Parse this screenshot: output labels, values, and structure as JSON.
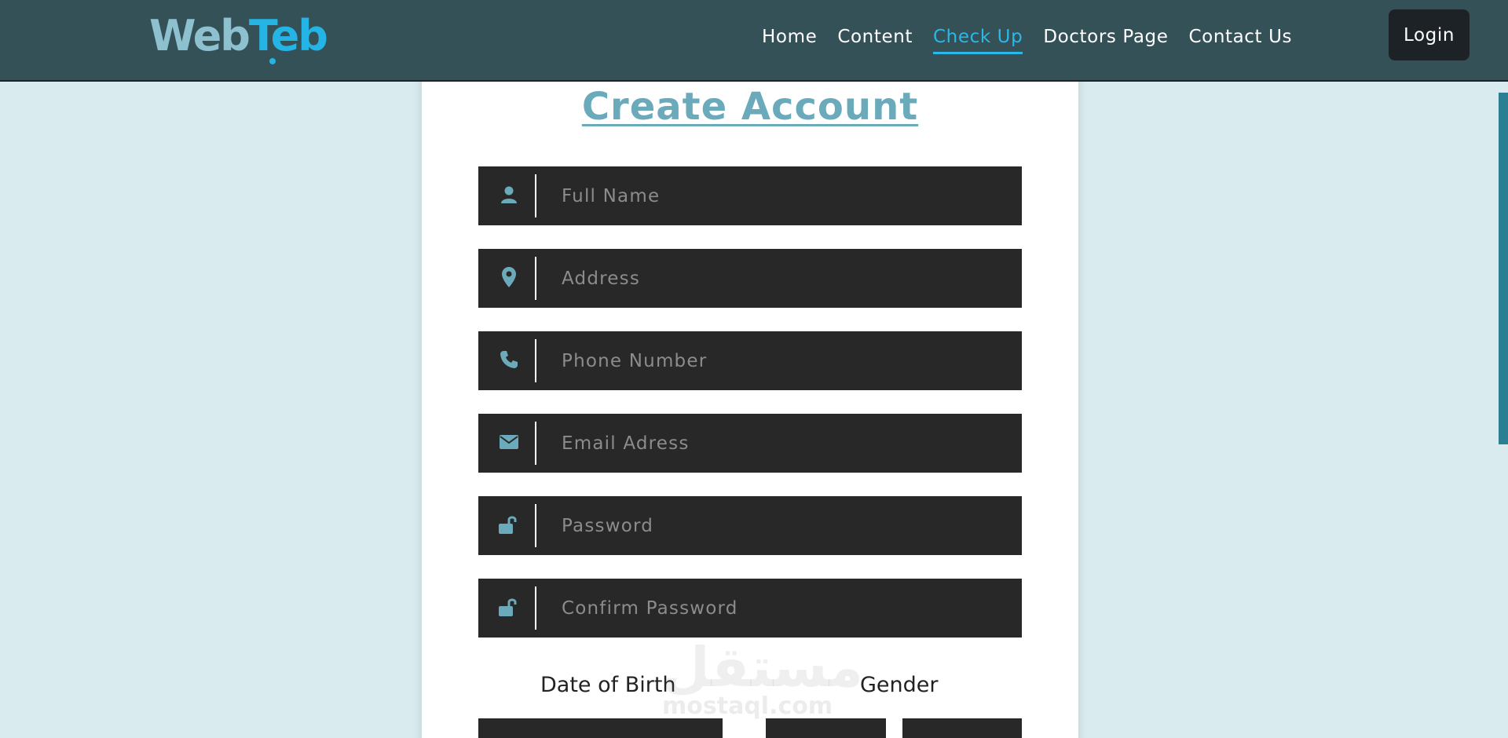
{
  "header": {
    "logo": {
      "part1": "Web",
      "part2": "Teb"
    },
    "nav": [
      {
        "label": "Home",
        "active": false
      },
      {
        "label": "Content",
        "active": false
      },
      {
        "label": "Check Up",
        "active": true
      },
      {
        "label": "Doctors Page",
        "active": false
      },
      {
        "label": "Contact Us",
        "active": false
      }
    ],
    "login_label": "Login"
  },
  "form": {
    "title": "Create Account",
    "fields": [
      {
        "icon": "user-icon",
        "placeholder": "Full Name",
        "value": ""
      },
      {
        "icon": "map-pin-icon",
        "placeholder": "Address",
        "value": ""
      },
      {
        "icon": "phone-icon",
        "placeholder": "Phone Number",
        "value": ""
      },
      {
        "icon": "envelope-icon",
        "placeholder": "Email Adress",
        "value": ""
      },
      {
        "icon": "unlock-icon",
        "placeholder": "Password",
        "value": ""
      },
      {
        "icon": "unlock-icon",
        "placeholder": "Confirm Password",
        "value": ""
      }
    ],
    "dob_label": "Date of Birth",
    "gender_label": "Gender"
  },
  "watermark": {
    "text": "مستقل",
    "sub": "mostaql.com"
  },
  "colors": {
    "header_bg": "#345158",
    "page_bg": "#d9ebef",
    "accent": "#2ab8e8",
    "title": "#6aaabb",
    "field_bg": "#282828",
    "icon": "#6aaabb"
  }
}
